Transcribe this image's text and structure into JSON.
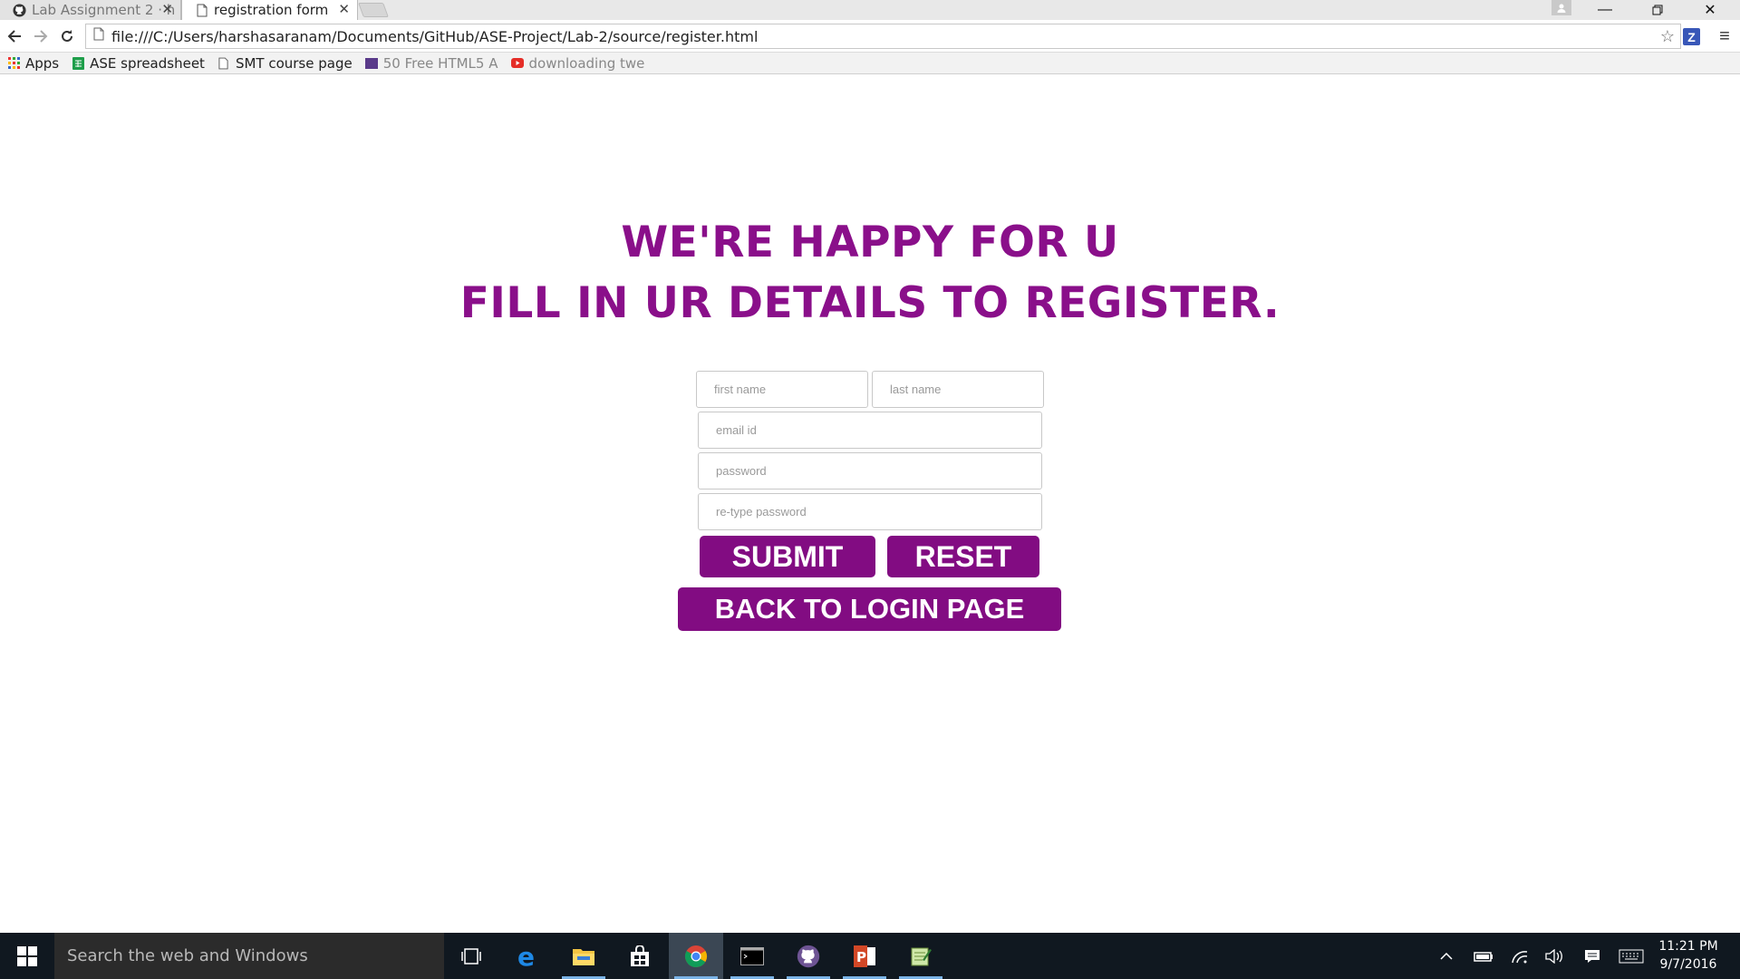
{
  "browser": {
    "tabs": [
      {
        "title": "Lab Assignment 2 · h",
        "icon": "github-icon",
        "active": false
      },
      {
        "title": "registration form",
        "icon": "page-icon",
        "active": true
      }
    ],
    "url": "file:///C:/Users/harshasaranam/Documents/GitHub/ASE-Project/Lab-2/source/register.html",
    "bookmarks": [
      {
        "label": "Apps",
        "icon": "apps-grid-icon"
      },
      {
        "label": "ASE spreadsheet",
        "icon": "spreadsheet-icon"
      },
      {
        "label": "SMT course page",
        "icon": "page-icon"
      },
      {
        "label": "50 Free HTML5 A",
        "icon": "html5-icon"
      },
      {
        "label": "downloading twe",
        "icon": "youtube-icon"
      }
    ]
  },
  "page": {
    "heading_line1": "WE'RE HAPPY FOR U",
    "heading_line2": "FILL IN UR DETAILS TO REGISTER.",
    "heading_color": "#8a0f8a",
    "button_color": "#820c82",
    "form": {
      "first_name_placeholder": "first name",
      "last_name_placeholder": "last name",
      "email_placeholder": "email id",
      "password_placeholder": "password",
      "retype_password_placeholder": "re-type password",
      "submit_label": "SUBMIT",
      "reset_label": "RESET",
      "back_label": "BACK TO LOGIN PAGE"
    }
  },
  "taskbar": {
    "search_placeholder": "Search the web and Windows",
    "apps": [
      "task-view-icon",
      "edge-icon",
      "file-explorer-icon",
      "store-icon",
      "chrome-icon",
      "cmd-icon",
      "github-desktop-icon",
      "powerpoint-icon",
      "notepad-icon"
    ],
    "time": "11:21 PM",
    "date": "9/7/2016"
  }
}
